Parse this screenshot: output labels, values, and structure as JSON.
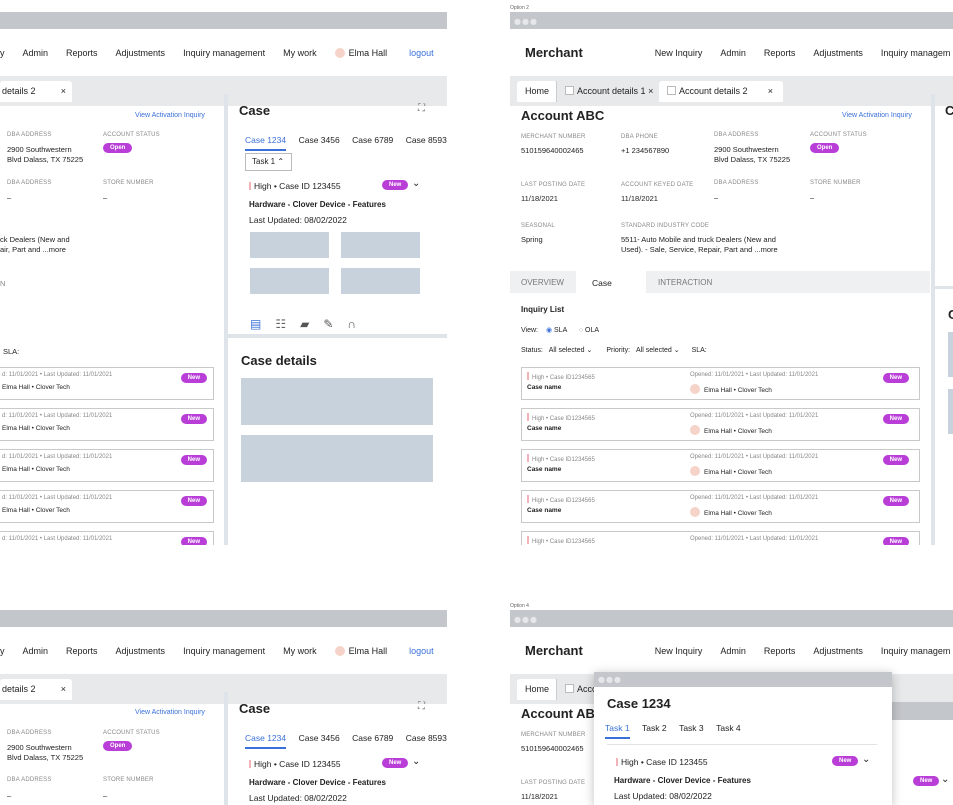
{
  "options": {
    "opt2": "Option 2",
    "opt4": "Option 4"
  },
  "nav": {
    "brand": "Merchant",
    "new_inquiry": "New Inquiry",
    "admin": "Admin",
    "reports": "Reports",
    "adjustments": "Adjustments",
    "inquiry_mgmt": "Inquiry management",
    "inquiry_mgmt_cut": "Inquiry managem",
    "my_work": "My work",
    "user": "Elma Hall",
    "logout": "logout"
  },
  "tabs": {
    "home": "Home",
    "acct1": "Account details 1",
    "acct2": "Account details 2",
    "acct2_cut": "details 2",
    "acc_cut": "Acco",
    "close": "×"
  },
  "account": {
    "title": "Account ABC",
    "title_cut": "Account ABC",
    "view_activation": "View Activation Inquiry",
    "merchant_number_label": "MERCHANT NUMBER",
    "merchant_number": "510159640002465",
    "dba_phone_label": "DBA PHONE",
    "dba_phone": "+1 234567890",
    "dba_address_label": "DBA ADDRESS",
    "dba_address_1": "2900 Southwestern",
    "dba_address_2": "Blvd Dalass, TX 75225",
    "account_status_label": "ACCOUNT STATUS",
    "account_status": "Open",
    "last_posting_label": "LAST POSTING DATE",
    "last_posting": "11/18/2021",
    "keyed_date_label": "ACCOUNT KEYED DATE",
    "keyed_date": "11/18/2021",
    "dba_address2_label": "DBA ADDRESS",
    "dash": "–",
    "store_number_label": "STORE NUMBER",
    "seasonal_label": "SEASONAL",
    "seasonal": "Spring",
    "sic_label": "STANDARD INDUSTRY CODE",
    "sic_1": "5511- Auto Mobile and truck Dealers (New and",
    "sic_2": "Used). - Sale, Service, Repair, Part and ...more",
    "sic_cut_1": "ck Dealers (New and",
    "sic_cut_2": "air, Part and ...more",
    "n_cut": "N"
  },
  "subtabs": {
    "overview": "OVERVIEW",
    "case": "Case",
    "interaction": "INTERACTION"
  },
  "inquiry": {
    "title": "Inquiry List",
    "view": "View:",
    "sla": "SLA",
    "ola": "OLA",
    "status": "Status:",
    "all_selected": "All selected",
    "priority": "Priority:",
    "sla_label": "SLA:",
    "sla_cut": "SLA:",
    "card_left": "High • Case ID1234565",
    "card_name": "Case name",
    "opened": "Opened: 11/01/2021 • Last Updated: 11/01/2021",
    "opened_cut": "d: 11/01/2021 • Last Updated: 11/01/2021",
    "who": "Elma Hall • Clover Tech",
    "new": "New"
  },
  "case": {
    "title": "Case",
    "tab1": "Case 1234",
    "tab2": "Case 3456",
    "tab3": "Case 6789",
    "tab4": "Case 8593",
    "task_select": "Task 1 ⌃",
    "task_label": "Task 1",
    "case_line": "High • Case ID 123455",
    "hw": "Hardware - Clover Device - Features",
    "updated": "Last Updated: 08/02/2022",
    "new": "New",
    "details": "Case details",
    "expand": "⛶"
  },
  "popup": {
    "title": "Case 1234",
    "t1": "Task 1",
    "t2": "Task 2",
    "t3": "Task 3",
    "t4": "Task 4",
    "case_line": "High • Case ID 123455",
    "hw": "Hardware - Clover Device - Features",
    "updated": "Last Updated: 08/02/2022",
    "new": "New"
  },
  "colors": {
    "accent": "#3a70d9",
    "badge": "#b93ed8",
    "placeholder": "#c7d2dc"
  }
}
